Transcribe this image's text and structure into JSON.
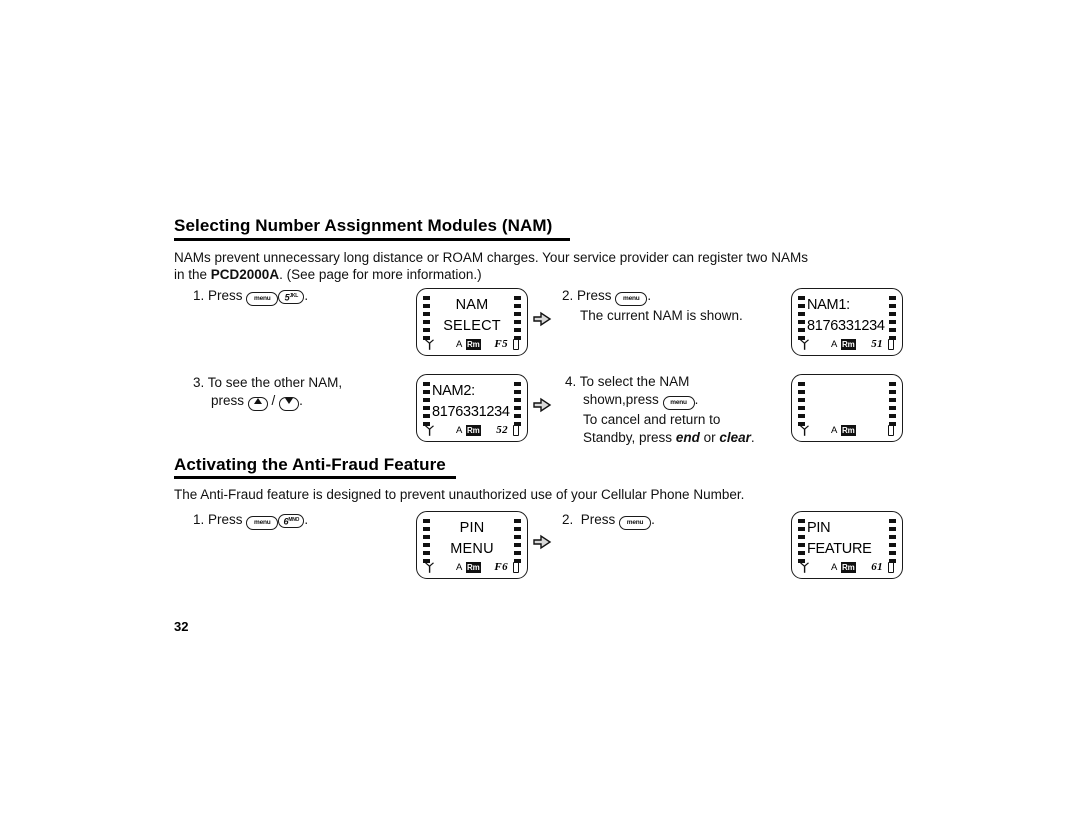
{
  "document": {
    "page_number": "32"
  },
  "sections": [
    {
      "heading": "Selecting Number Assignment Modules (NAM)",
      "intro_line1_a": "NAMs prevent unnecessary long distance or ROAM charges. Your service provider can register two NAMs",
      "intro_line2_a": "in the ",
      "intro_line2_bold": "PCD2000A",
      "intro_line2_b": ". (See page  for more information.)",
      "steps": {
        "s1_num": "1.",
        "s1_press": "Press",
        "s1_key_menu": "menu",
        "s1_key_num": "5",
        "s1_key_num_sup": "JKL",
        "s1_period": ".",
        "s2_num": "2.",
        "s2_press": "Press",
        "s2_key_menu": "menu",
        "s2_period": ".",
        "s2_line2": "The current NAM is shown.",
        "s3_num": "3.",
        "s3_line1": "To see the other NAM,",
        "s3_press": "press",
        "s3_slash": "/",
        "s3_period": ".",
        "s4_num": "4.",
        "s4_line1": "To select the NAM",
        "s4_line2_a": "shown,press",
        "s4_key_menu": "menu",
        "s4_line2_b": ".",
        "s4_line3": "To cancel and return to",
        "s4_line4_a": "Standby, press ",
        "s4_line4_end": "end",
        "s4_line4_or": " or ",
        "s4_line4_clear": "clear",
        "s4_line4_b": "."
      }
    },
    {
      "heading": "Activating the Anti-Fraud Feature",
      "intro_line1_a": "The Anti-Fraud feature is designed to prevent unauthorized use of your Cellular Phone Number.",
      "steps": {
        "s1_num": "1.",
        "s1_press": "Press",
        "s1_key_menu": "menu",
        "s1_key_num": "6",
        "s1_key_num_sup": "MNO",
        "s1_period": ".",
        "s2_num": "2.",
        "s2_press": "Press",
        "s2_key_menu": "menu",
        "s2_period": "."
      }
    }
  ],
  "displays": [
    {
      "id": "nam-select",
      "line1": "NAM",
      "line2": "SELECT",
      "align": "center",
      "status": {
        "letter": "A",
        "roam": "Rm",
        "code": "F5"
      }
    },
    {
      "id": "nam1",
      "line1": "NAM1:",
      "line2": "8176331234",
      "align": "left",
      "status": {
        "letter": "A",
        "roam": "Rm",
        "code": "51"
      }
    },
    {
      "id": "nam2",
      "line1": "NAM2:",
      "line2": "8176331234",
      "align": "left",
      "status": {
        "letter": "A",
        "roam": "Rm",
        "code": "52"
      }
    },
    {
      "id": "blank",
      "line1": "",
      "line2": "",
      "align": "center",
      "status": {
        "letter": "A",
        "roam": "Rm",
        "code": ""
      }
    },
    {
      "id": "pin-menu",
      "line1": "PIN",
      "line2": "MENU",
      "align": "center",
      "status": {
        "letter": "A",
        "roam": "Rm",
        "code": "F6"
      }
    },
    {
      "id": "pin-feature",
      "line1": "PIN",
      "line2": "FEATURE",
      "align": "left",
      "status": {
        "letter": "A",
        "roam": "Rm",
        "code": "61"
      }
    }
  ],
  "icons": {
    "arrow_right": "right-block-arrow",
    "antenna": "antenna-icon",
    "battery": "battery-icon",
    "up_key": "up-arrow-key",
    "down_key": "down-arrow-key"
  }
}
